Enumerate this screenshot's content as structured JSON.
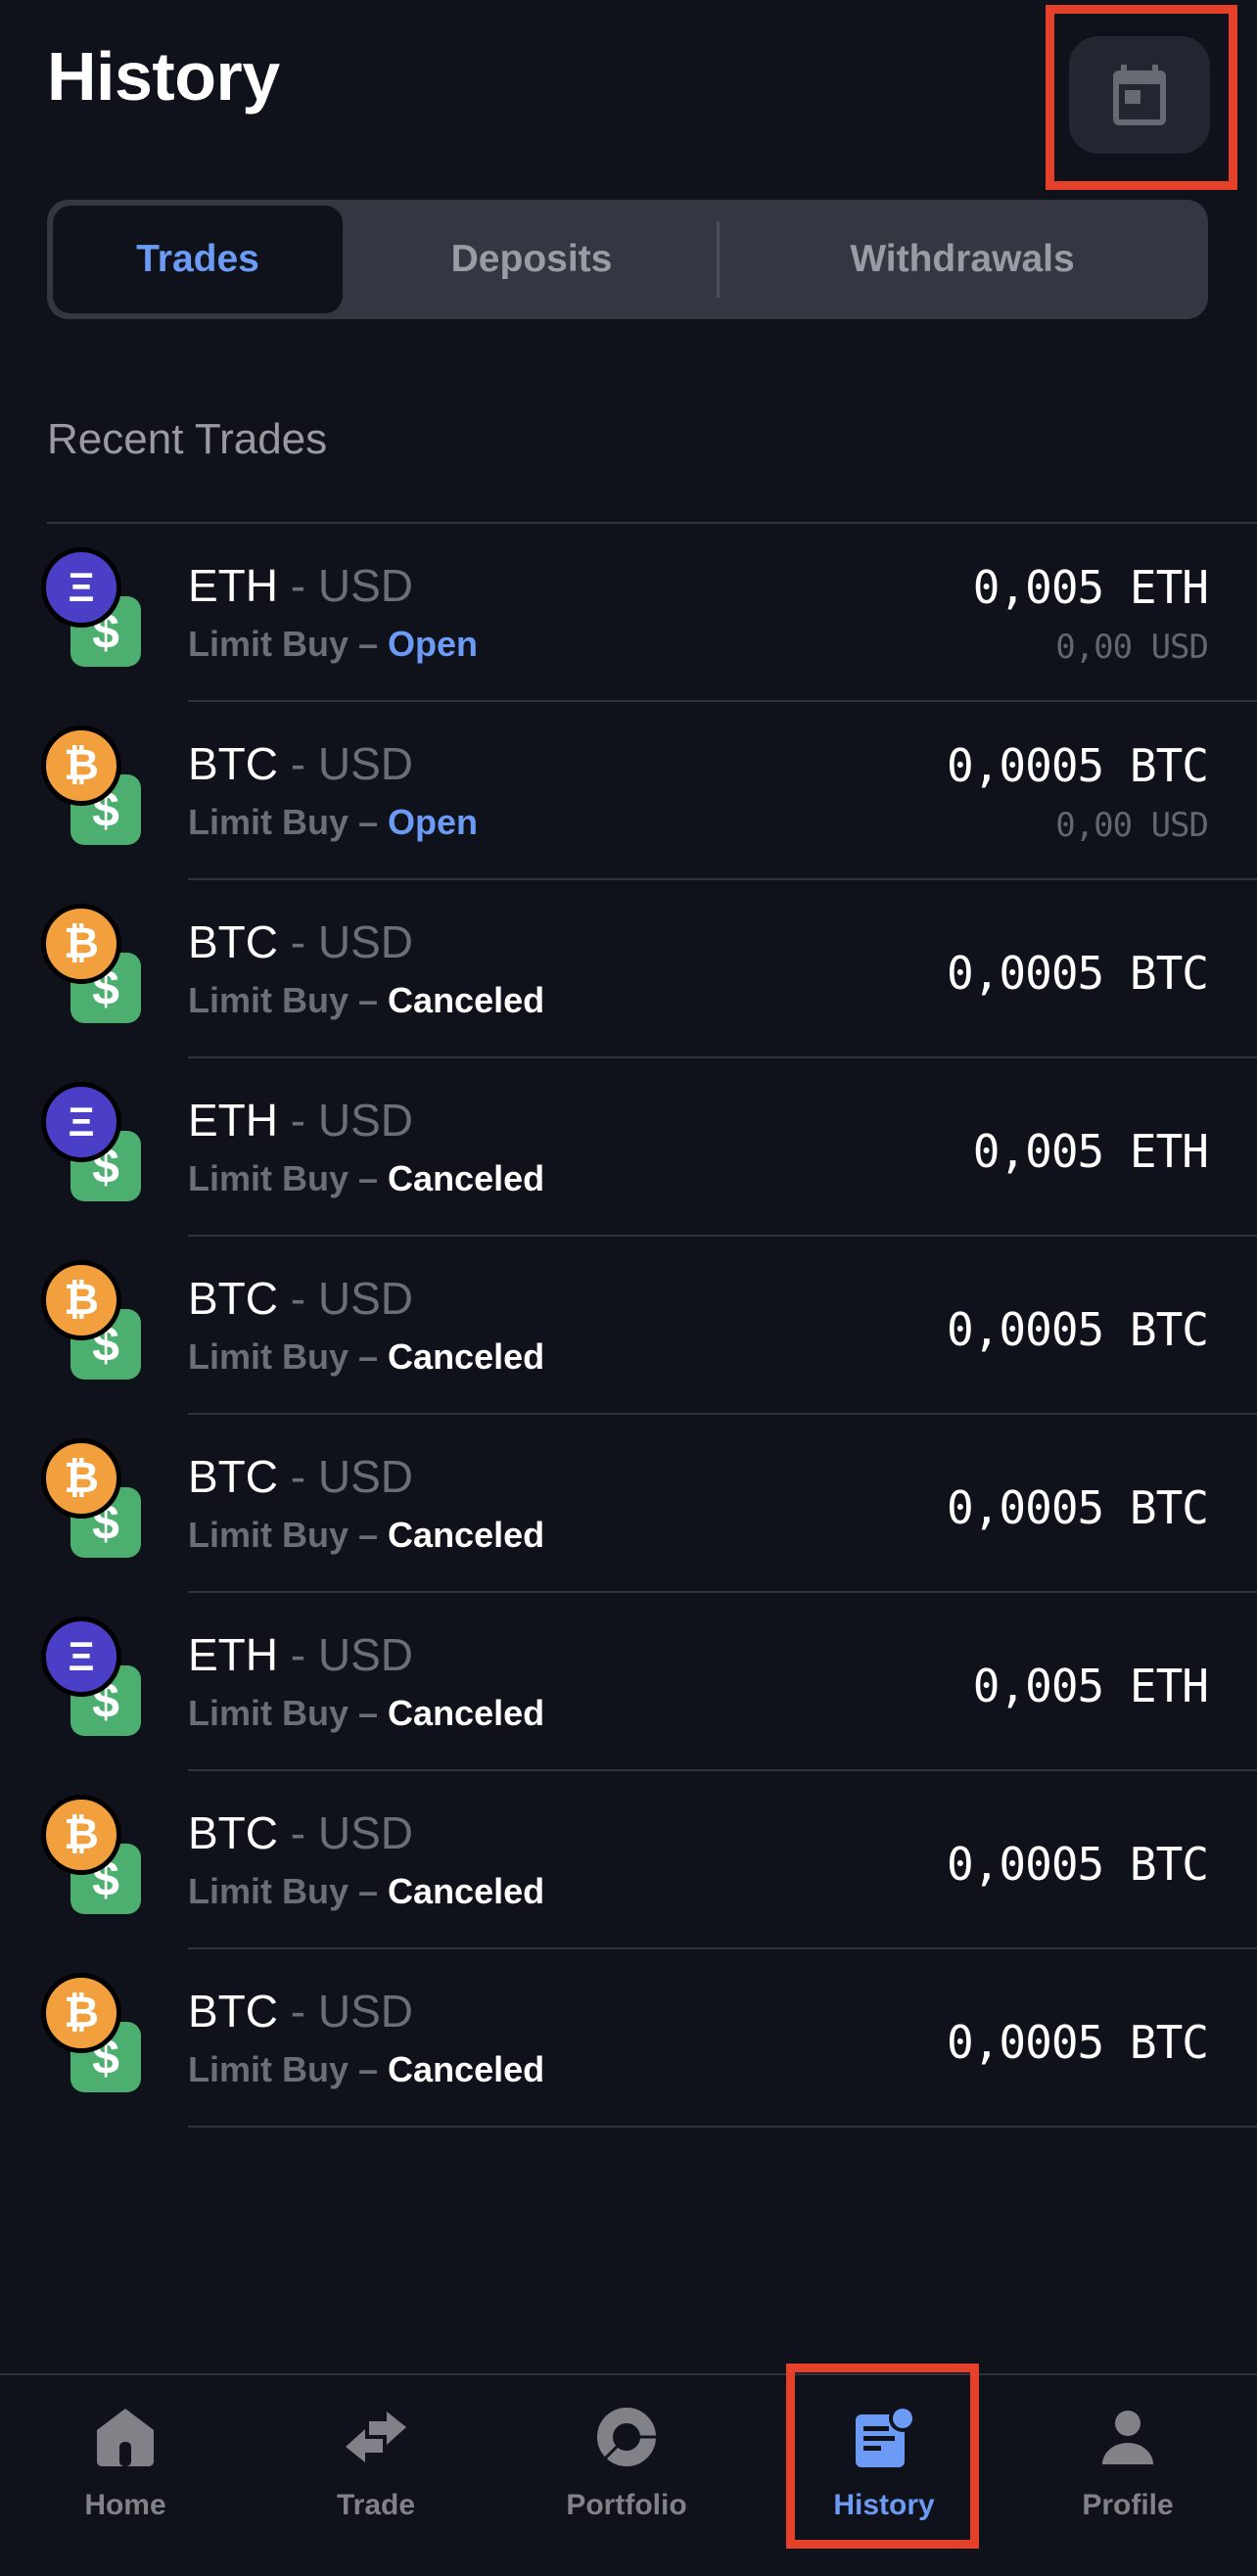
{
  "header": {
    "title": "History",
    "calendar_button": {
      "icon": "calendar-icon",
      "highlighted": true
    }
  },
  "tabs": [
    {
      "label": "Trades",
      "active": true
    },
    {
      "label": "Deposits",
      "active": false
    },
    {
      "label": "Withdrawals",
      "active": false
    }
  ],
  "section_title": "Recent Trades",
  "trades": [
    {
      "base": "ETH",
      "sep": " - ",
      "quote": "USD",
      "type": "Limit Buy",
      "dash": " – ",
      "status": "Open",
      "amount": "0,005 ETH",
      "value": "0,00 USD"
    },
    {
      "base": "BTC",
      "sep": " - ",
      "quote": "USD",
      "type": "Limit Buy",
      "dash": " – ",
      "status": "Open",
      "amount": "0,0005 BTC",
      "value": "0,00 USD"
    },
    {
      "base": "BTC",
      "sep": " - ",
      "quote": "USD",
      "type": "Limit Buy",
      "dash": " – ",
      "status": "Canceled",
      "amount": "0,0005 BTC",
      "value": null
    },
    {
      "base": "ETH",
      "sep": " - ",
      "quote": "USD",
      "type": "Limit Buy",
      "dash": " – ",
      "status": "Canceled",
      "amount": "0,005 ETH",
      "value": null
    },
    {
      "base": "BTC",
      "sep": " - ",
      "quote": "USD",
      "type": "Limit Buy",
      "dash": " – ",
      "status": "Canceled",
      "amount": "0,0005 BTC",
      "value": null
    },
    {
      "base": "BTC",
      "sep": " - ",
      "quote": "USD",
      "type": "Limit Buy",
      "dash": " – ",
      "status": "Canceled",
      "amount": "0,0005 BTC",
      "value": null
    },
    {
      "base": "ETH",
      "sep": " - ",
      "quote": "USD",
      "type": "Limit Buy",
      "dash": " – ",
      "status": "Canceled",
      "amount": "0,005 ETH",
      "value": null
    },
    {
      "base": "BTC",
      "sep": " - ",
      "quote": "USD",
      "type": "Limit Buy",
      "dash": " – ",
      "status": "Canceled",
      "amount": "0,0005 BTC",
      "value": null
    },
    {
      "base": "BTC",
      "sep": " - ",
      "quote": "USD",
      "type": "Limit Buy",
      "dash": " – ",
      "status": "Canceled",
      "amount": "0,0005 BTC",
      "value": null
    }
  ],
  "coin_icons": {
    "ETH": {
      "glyph": "Ξ",
      "color": "#4a3fc6"
    },
    "BTC": {
      "glyph": "₿",
      "color": "#f2a03d"
    },
    "USD": {
      "glyph": "$",
      "color": "#4caf6f"
    }
  },
  "status_colors": {
    "Open": "#6c9bf5",
    "Canceled": "#ffffff"
  },
  "nav": [
    {
      "label": "Home",
      "icon": "home-icon",
      "active": false
    },
    {
      "label": "Trade",
      "icon": "swap-arrows-icon",
      "active": false
    },
    {
      "label": "Portfolio",
      "icon": "donut-chart-icon",
      "active": false
    },
    {
      "label": "History",
      "icon": "document-badge-icon",
      "active": true,
      "highlighted": true
    },
    {
      "label": "Profile",
      "icon": "person-icon",
      "active": false
    }
  ],
  "colors": {
    "accent": "#6c9bf5",
    "highlight": "#e5412a",
    "background": "#0f121b"
  }
}
